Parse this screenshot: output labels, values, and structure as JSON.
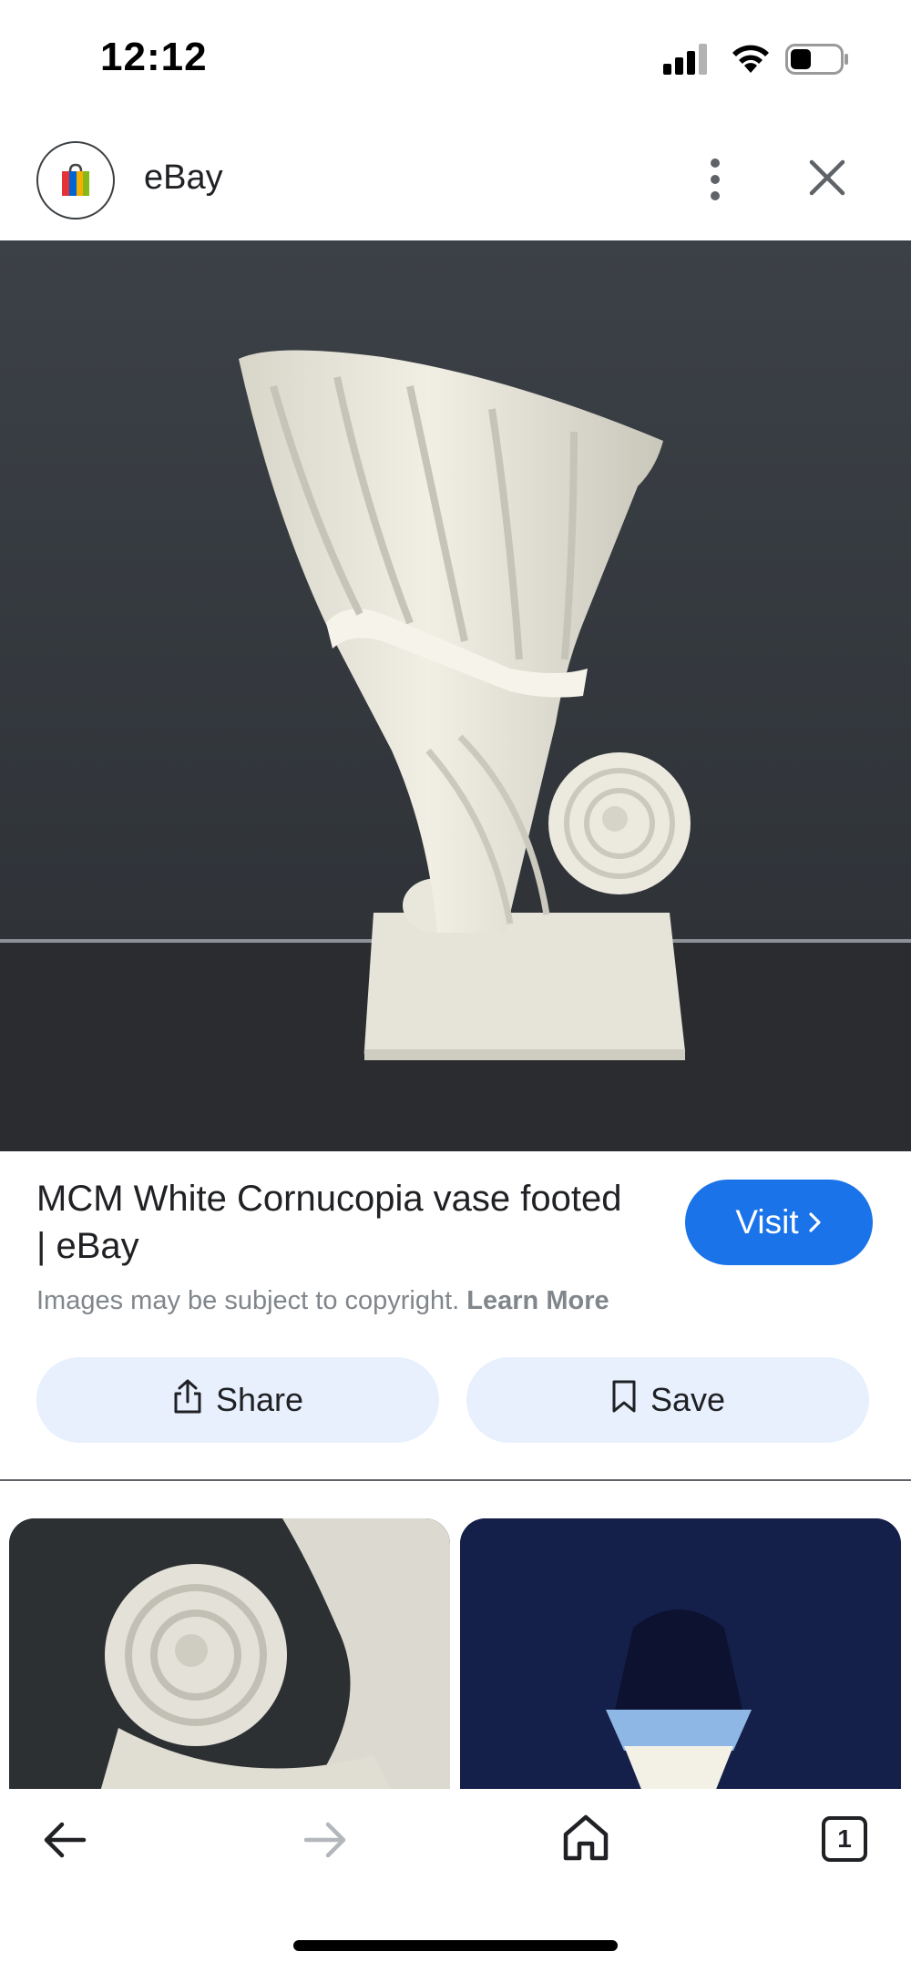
{
  "status": {
    "time": "12:12"
  },
  "header": {
    "site_name": "eBay"
  },
  "result": {
    "title": "MCM White Cornucopia vase footed | eBay",
    "visit_label": "Visit",
    "copyright_text": "Images may be subject to copyright.",
    "learn_more_label": "Learn More"
  },
  "actions": {
    "share_label": "Share",
    "save_label": "Save"
  },
  "bottom_nav": {
    "tab_count": "1"
  },
  "colors": {
    "accent": "#1a73e8",
    "pill_bg": "#e8f0fe"
  },
  "icons": [
    "ebay-bag-icon",
    "more-vert-icon",
    "close-icon",
    "share-icon",
    "bookmark-icon",
    "back-arrow-icon",
    "forward-arrow-icon",
    "home-icon",
    "tabs-icon"
  ]
}
